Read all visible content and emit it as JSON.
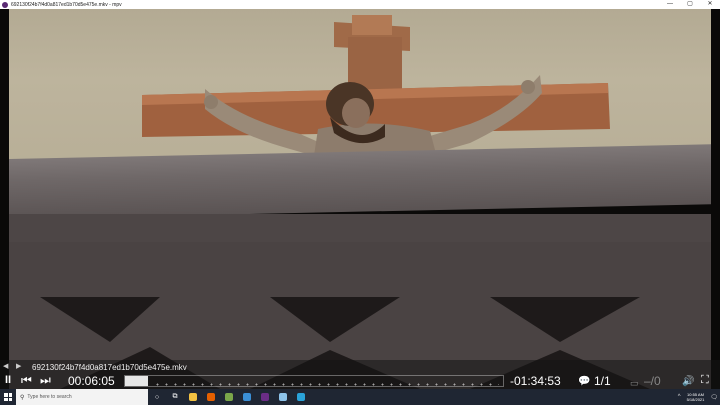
{
  "window": {
    "title": "692130f24b7f4d0a817ed1b70d5e475e.mkv - mpv",
    "minimize_glyph": "—",
    "maximize_glyph": "▢",
    "close_glyph": "✕"
  },
  "player": {
    "filename": "692130f24b7f4d0a817ed1b70d5e475e.mkv",
    "elapsed": "00:06:05",
    "remaining": "-01:34:53",
    "progress": 0.06,
    "subtitle_track": "1/1",
    "audio_track": "–/0",
    "play_pause_glyph": "II",
    "prev_glyph": "⏮",
    "next_glyph": "⏭",
    "subtitle_glyph": "💬",
    "volume_glyph": "🔊",
    "fullscreen_glyph": "⛶",
    "playlist_prev_glyph": "◀",
    "playlist_next_glyph": "▶",
    "colors": {
      "accent": "#ffffff",
      "bar_fill": "#e6e6e6"
    }
  },
  "taskbar": {
    "search_placeholder": "Type here to search",
    "search_glyph": "⚲",
    "clock_time": "10:55 AM",
    "clock_date": "5/18/2021",
    "tray_up_glyph": "^",
    "notification_glyph": "🗨",
    "apps": [
      {
        "name": "cortana-icon",
        "color": "#ffffff",
        "glyph": "○"
      },
      {
        "name": "task-view-icon",
        "color": "#ffffff",
        "glyph": "⧉"
      },
      {
        "name": "file-explorer-icon",
        "color": "#f3c242",
        "glyph": ""
      },
      {
        "name": "firefox-icon",
        "color": "#e66000",
        "glyph": ""
      },
      {
        "name": "app-icon-1",
        "color": "#7aa64a",
        "glyph": ""
      },
      {
        "name": "app-icon-2",
        "color": "#3b8fd6",
        "glyph": ""
      },
      {
        "name": "mpv-icon",
        "color": "#6b2d86",
        "glyph": ""
      },
      {
        "name": "app-icon-3",
        "color": "#8dc3ea",
        "glyph": ""
      },
      {
        "name": "edge-icon",
        "color": "#2aa3d9",
        "glyph": ""
      }
    ]
  }
}
